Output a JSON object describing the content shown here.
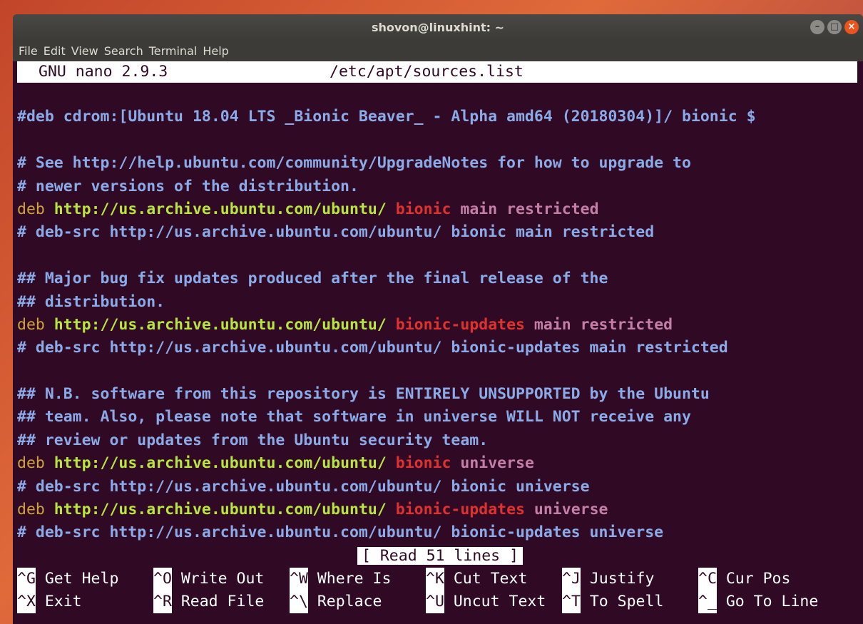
{
  "window": {
    "title": "shovon@linuxhint: ~",
    "controls": [
      "–",
      "□",
      "×"
    ]
  },
  "menu": [
    "File",
    "Edit",
    "View",
    "Search",
    "Terminal",
    "Help"
  ],
  "nano": {
    "version": "GNU nano 2.9.3",
    "filename": "/etc/apt/sources.list",
    "status": "[ Read 51 lines ]"
  },
  "lines": [
    {
      "type": "blank"
    },
    {
      "type": "comment",
      "text": "#deb cdrom:[Ubuntu 18.04 LTS _Bionic Beaver_ - Alpha amd64 (20180304)]/ bionic $"
    },
    {
      "type": "blank"
    },
    {
      "type": "comment",
      "text": "# See http://help.ubuntu.com/community/UpgradeNotes for how to upgrade to"
    },
    {
      "type": "comment",
      "text": "# newer versions of the distribution."
    },
    {
      "type": "deb",
      "deb": "deb",
      "url": "http://us.archive.ubuntu.com/ubuntu/",
      "dist": "bionic",
      "comp": "main restricted"
    },
    {
      "type": "comment",
      "text": "# deb-src http://us.archive.ubuntu.com/ubuntu/ bionic main restricted"
    },
    {
      "type": "blank"
    },
    {
      "type": "comment",
      "text": "## Major bug fix updates produced after the final release of the"
    },
    {
      "type": "comment",
      "text": "## distribution."
    },
    {
      "type": "deb",
      "deb": "deb",
      "url": "http://us.archive.ubuntu.com/ubuntu/",
      "dist": "bionic-updates",
      "comp": "main restricted"
    },
    {
      "type": "comment",
      "text": "# deb-src http://us.archive.ubuntu.com/ubuntu/ bionic-updates main restricted"
    },
    {
      "type": "blank"
    },
    {
      "type": "comment",
      "text": "## N.B. software from this repository is ENTIRELY UNSUPPORTED by the Ubuntu"
    },
    {
      "type": "comment",
      "text": "## team. Also, please note that software in universe WILL NOT receive any"
    },
    {
      "type": "comment",
      "text": "## review or updates from the Ubuntu security team."
    },
    {
      "type": "deb",
      "deb": "deb",
      "url": "http://us.archive.ubuntu.com/ubuntu/",
      "dist": "bionic",
      "comp": "universe"
    },
    {
      "type": "comment",
      "text": "# deb-src http://us.archive.ubuntu.com/ubuntu/ bionic universe"
    },
    {
      "type": "deb",
      "deb": "deb",
      "url": "http://us.archive.ubuntu.com/ubuntu/",
      "dist": "bionic-updates",
      "comp": "universe"
    },
    {
      "type": "comment",
      "text": "# deb-src http://us.archive.ubuntu.com/ubuntu/ bionic-updates universe"
    }
  ],
  "shortcuts": [
    [
      {
        "key": "^G",
        "label": " Get Help"
      },
      {
        "key": "^O",
        "label": " Write Out"
      },
      {
        "key": "^W",
        "label": " Where Is"
      },
      {
        "key": "^K",
        "label": " Cut Text"
      },
      {
        "key": "^J",
        "label": " Justify"
      },
      {
        "key": "^C",
        "label": " Cur Pos"
      }
    ],
    [
      {
        "key": "^X",
        "label": " Exit"
      },
      {
        "key": "^R",
        "label": " Read File"
      },
      {
        "key": "^\\",
        "label": " Replace"
      },
      {
        "key": "^U",
        "label": " Uncut Text"
      },
      {
        "key": "^T",
        "label": " To Spell"
      },
      {
        "key": "^_",
        "label": " Go To Line"
      }
    ]
  ]
}
